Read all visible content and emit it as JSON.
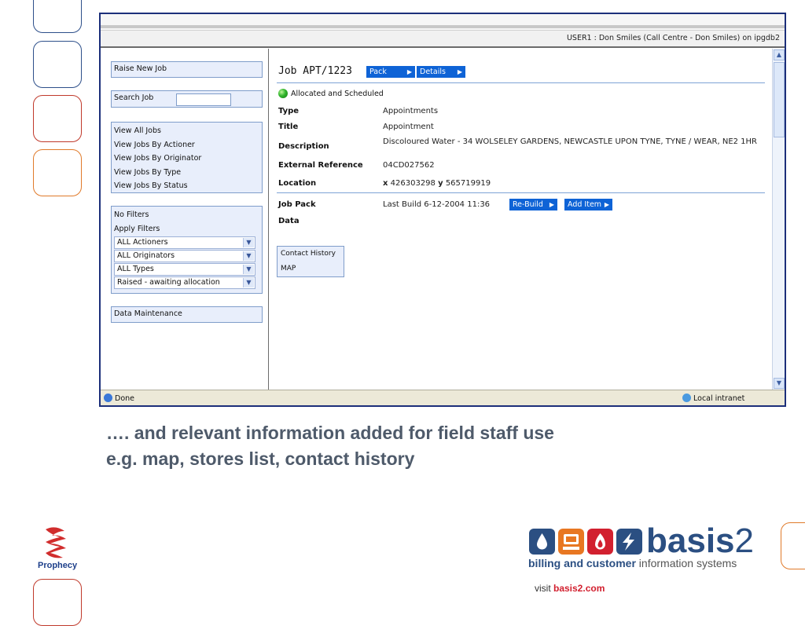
{
  "window": {
    "user_line": "USER1 : Don Smiles (Call Centre - Don Smiles) on ipgdb2"
  },
  "sidebar": {
    "raise_new_job": "Raise New Job",
    "search_job": "Search Job",
    "search_value": "",
    "view_links": [
      "View All Jobs",
      "View Jobs By Actioner",
      "View Jobs By Originator",
      "View Jobs By Type",
      "View Jobs By Status"
    ],
    "filters": {
      "no_filters": "No Filters",
      "apply_filters": "Apply Filters",
      "selects": [
        "ALL Actioners",
        "ALL Originators",
        "ALL Types",
        "Raised - awaiting allocation"
      ]
    },
    "data_maintenance": "Data Maintenance"
  },
  "job": {
    "title": "Job APT/1223",
    "pack_btn": "Pack",
    "details_btn": "Details",
    "status": "Allocated and Scheduled",
    "status_color": "#30b52c",
    "fields": {
      "type_label": "Type",
      "type_value": "Appointments",
      "title_label": "Title",
      "title_value": "Appointment",
      "desc_label": "Description",
      "desc_value": "Discoloured Water - 34 WOLSELEY GARDENS, NEWCASTLE UPON TYNE, TYNE / WEAR, NE2 1HR",
      "extref_label": "External Reference",
      "extref_value": "04CD027562",
      "location_label": "Location",
      "loc_x_label": "x",
      "loc_x": "426303298",
      "loc_y_label": "y",
      "loc_y": "565719919"
    },
    "pack": {
      "job_pack_label": "Job Pack",
      "last_build": "Last Build 6-12-2004 11:36",
      "rebuild_btn": "Re-Build",
      "add_item_btn": "Add Item",
      "data_label": "Data",
      "links": [
        "Contact History",
        "MAP"
      ]
    }
  },
  "statusbar": {
    "left": "Done",
    "zone": "Local intranet"
  },
  "caption": {
    "line1": "…. and relevant information added for field staff use",
    "line2": "e.g. map, stores list, contact history"
  },
  "logos": {
    "prophecy": "Prophecy",
    "basis_word": "basis",
    "basis_num": "2",
    "tag_bold": "billing and customer",
    "tag_rest": " information systems",
    "visit_prefix": "visit ",
    "visit_link": "basis2.com"
  },
  "colors": {
    "accent_blue": "#0e63d6",
    "panel_bg": "#e8eefb",
    "caption": "#4e5a6a",
    "brand_navy": "#2b4f82",
    "link_red": "#d2202f"
  }
}
